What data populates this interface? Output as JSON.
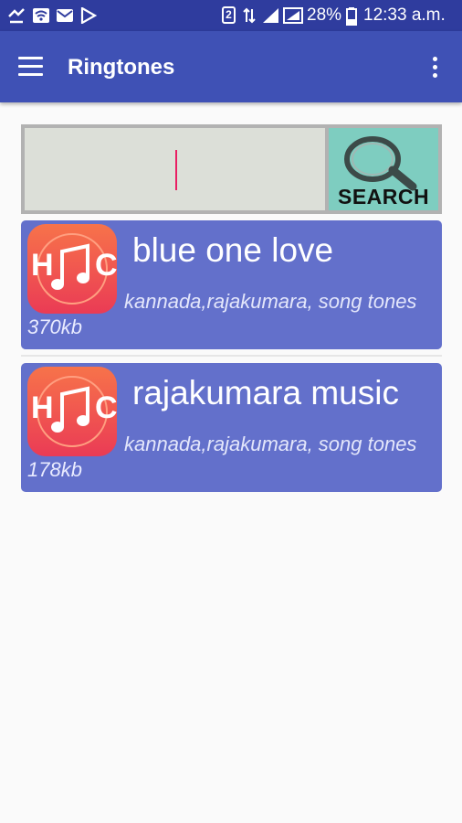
{
  "status_bar": {
    "battery_percent": "28%",
    "time": "12:33 a.m.",
    "sim_badge": "2"
  },
  "app_bar": {
    "title": "Ringtones"
  },
  "search": {
    "value": "",
    "button_label": "SEARCH"
  },
  "results": [
    {
      "title": "blue one love",
      "tags": "kannada,rajakumara, song tones",
      "size": "370kb"
    },
    {
      "title": "rajakumara music",
      "tags": "kannada,rajakumara, song tones",
      "size": "178kb"
    }
  ],
  "colors": {
    "app_bar": "#3f51b5",
    "status_bar": "#2f3c9e",
    "card": "#6370cb",
    "search_button": "#7ecdc0",
    "cursor": "#e91e63"
  },
  "icons": {
    "app_icon": "hc-music-icon",
    "search": "magnifier-icon"
  }
}
